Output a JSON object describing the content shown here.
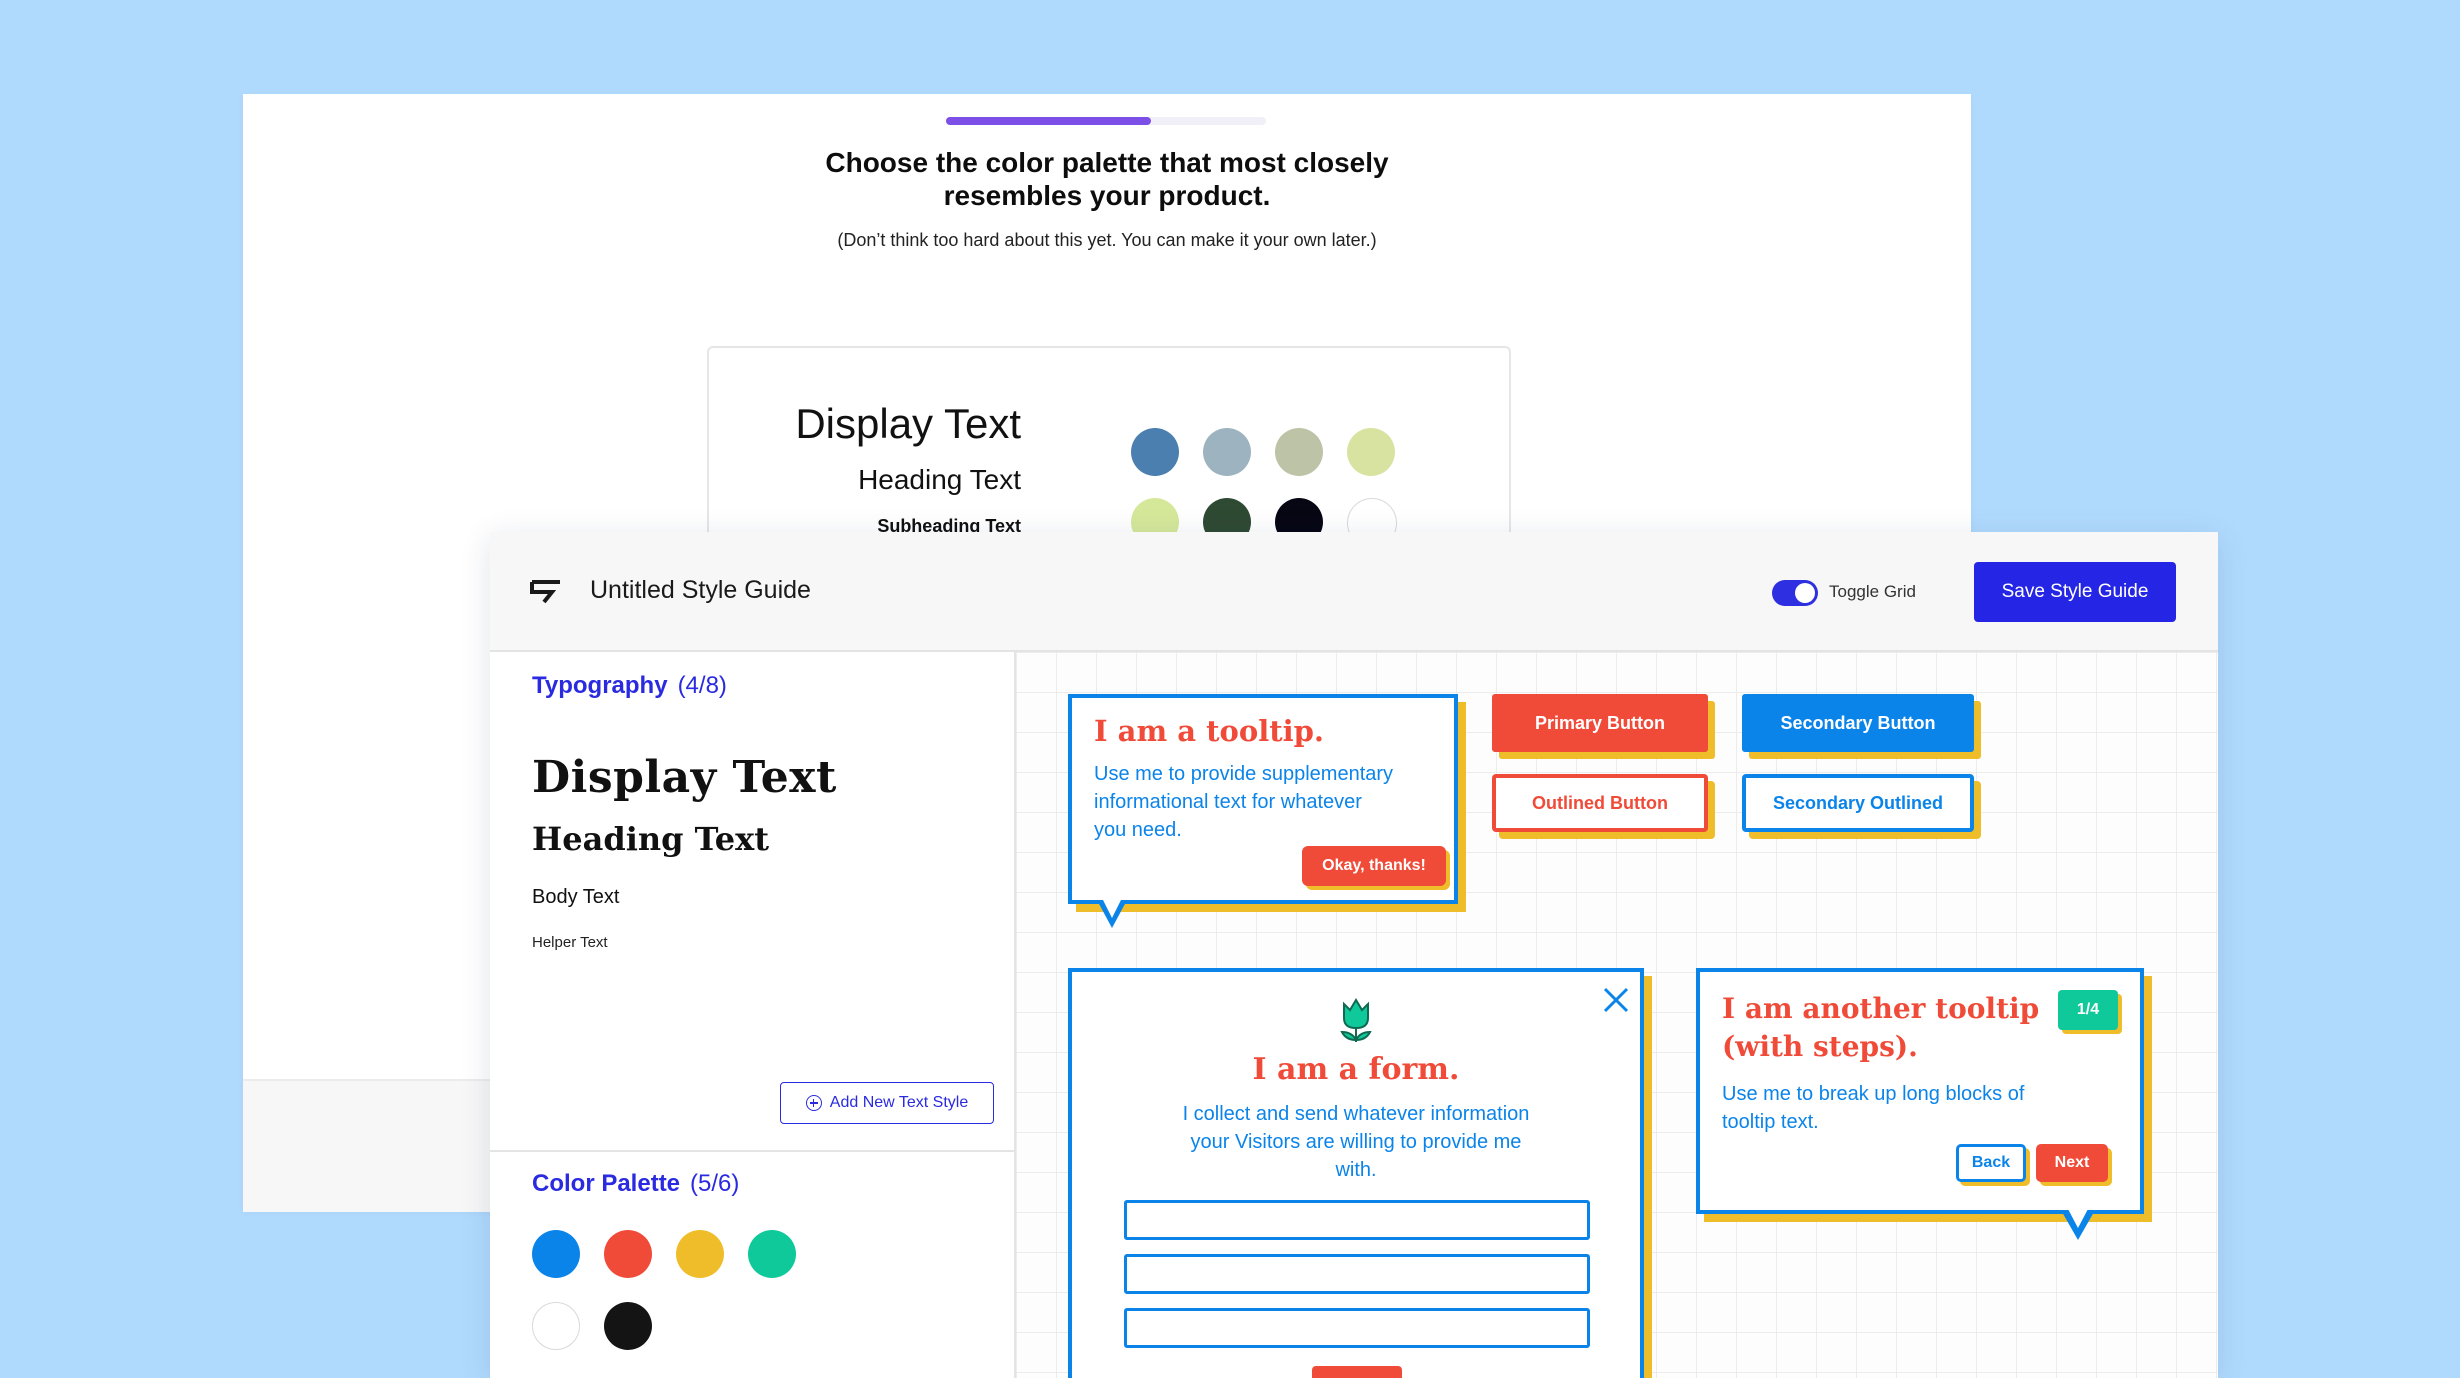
{
  "back_window": {
    "progress": 0.64,
    "progress_color": "#7c50e6",
    "title_line1": "Choose the color palette that most closely",
    "title_line2": "resembles your product.",
    "subtitle": "(Don’t think too hard about this yet. You can make it your own later.)",
    "preview": {
      "display": "Display Text",
      "heading": "Heading Text",
      "subheading": "Subheading Text",
      "colors": [
        "#4a7fb0",
        "#9db3bf",
        "#bcc3a6",
        "#d8e3a1",
        "#d5e89a",
        "#2f4a33",
        "#070714",
        "#ffffff"
      ]
    }
  },
  "front_window": {
    "title": "Untitled Style Guide",
    "toggle_label": "Toggle Grid",
    "toggle_on": true,
    "save_label": "Save Style Guide",
    "typography": {
      "title": "Typography",
      "count": "(4/8)",
      "display": "Display Text",
      "heading": "Heading Text",
      "body": "Body Text",
      "helper": "Helper Text",
      "add_label": "Add New Text Style"
    },
    "color_palette": {
      "title": "Color Palette",
      "count": "(5/6)",
      "colors": [
        "#0b84ea",
        "#f04b38",
        "#efbd2a",
        "#10c99a",
        "#ffffff",
        "#141414"
      ]
    },
    "canvas": {
      "tooltip": {
        "title": "I am a tooltip.",
        "line1": "Use me to provide supplementary",
        "line2": "informational text for whatever",
        "line3": "you need.",
        "button": "Okay, thanks!"
      },
      "buttons": {
        "primary": "Primary Button",
        "secondary": "Secondary Button",
        "outlined": "Outlined Button",
        "secondary_outlined": "Secondary Outlined"
      },
      "form": {
        "title": "I am a form.",
        "line1": "I collect and send whatever information",
        "line2": "your Visitors are willing to provide me",
        "line3": "with."
      },
      "steps_tooltip": {
        "title_line1": "I am another tooltip",
        "title_line2": "(with steps).",
        "badge": "1/4",
        "line1": "Use me to break up long blocks of",
        "line2": "tooltip text.",
        "back": "Back",
        "next": "Next"
      },
      "colors": {
        "blue": "#0b84ea",
        "red": "#f04b38",
        "yellow": "#efbd2a",
        "green": "#10c99a"
      }
    }
  }
}
